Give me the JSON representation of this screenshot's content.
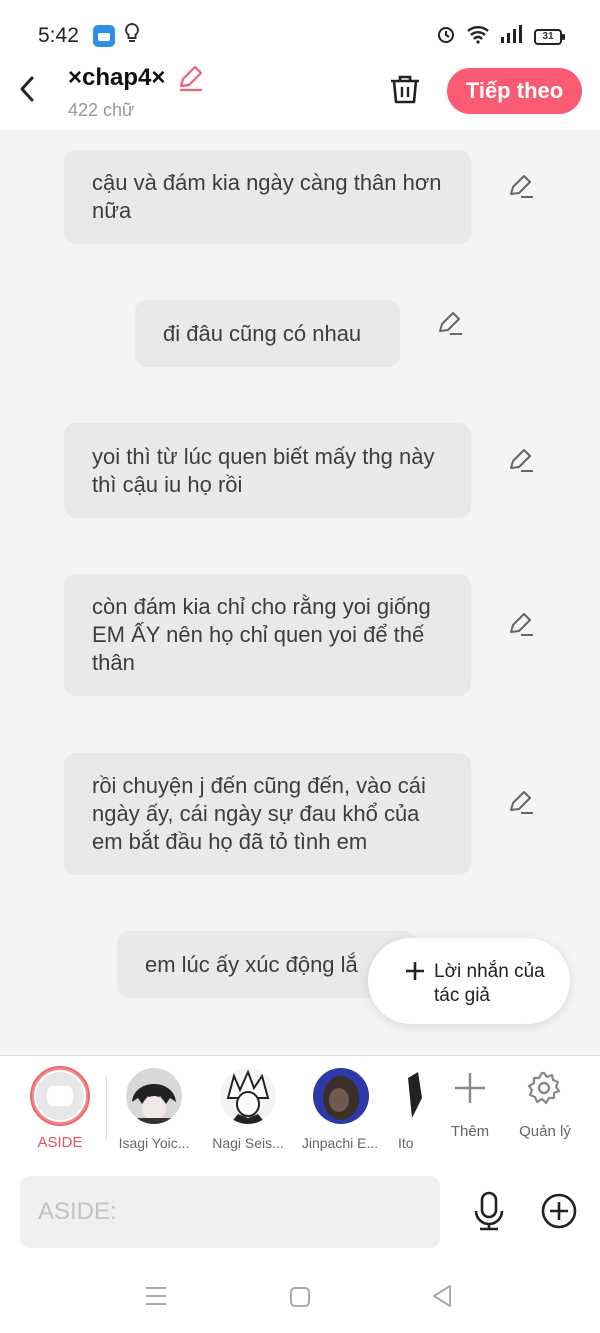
{
  "status_bar": {
    "time": "5:42",
    "battery": "31"
  },
  "header": {
    "title": "×chap4×",
    "word_count": "422 chữ",
    "next_label": "Tiếp theo"
  },
  "messages": [
    {
      "text": "cậu và đám kia ngày càng thân hơn nữa"
    },
    {
      "text": "đi đâu cũng có nhau"
    },
    {
      "text": "yoi thì từ lúc quen biết mấy thg này thì cậu iu họ rồi"
    },
    {
      "text": "còn đám kia chỉ cho rằng yoi giống EM ẤY nên họ chỉ quen yoi để thế thân"
    },
    {
      "text": "rồi chuyện j đến cũng đến, vào cái ngày ấy, cái ngày sự đau khổ của em bắt đầu họ đã tỏ tình em"
    },
    {
      "text": "em lúc ấy xúc động lắ"
    }
  ],
  "fab": {
    "label": "Lời nhắn của tác giả"
  },
  "characters": {
    "aside_label": "ASIDE",
    "items": [
      {
        "name": "Isagi Yoic..."
      },
      {
        "name": "Nagi Seis..."
      },
      {
        "name": "Jinpachi E..."
      },
      {
        "name": "Ito"
      }
    ],
    "add_label": "Thêm",
    "manage_label": "Quản lý"
  },
  "input": {
    "placeholder": "ASIDE:"
  },
  "colors": {
    "accent": "#fb5a73",
    "bubble": "#e9e9e9",
    "background": "#f4f4f4"
  },
  "icons": [
    "back-icon",
    "edit-icon",
    "trash-icon",
    "pencil-icon",
    "plus-icon",
    "settings-icon",
    "mic-icon",
    "add-circle-icon"
  ]
}
